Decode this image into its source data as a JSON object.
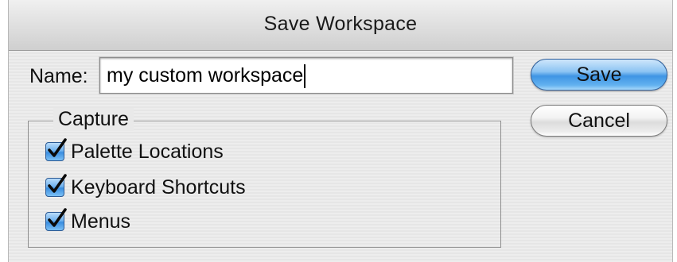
{
  "dialog": {
    "title": "Save Workspace",
    "name_label": "Name:",
    "name_value": "my custom workspace",
    "buttons": {
      "save": "Save",
      "cancel": "Cancel"
    },
    "capture": {
      "title": "Capture",
      "options": [
        {
          "label": "Palette Locations",
          "checked": true
        },
        {
          "label": "Keyboard Shortcuts",
          "checked": true
        },
        {
          "label": "Menus",
          "checked": true
        }
      ]
    }
  },
  "colors": {
    "default_button": "#4a9ce6",
    "checkbox": "#5aa7ec"
  },
  "icons": {
    "checkmark": "checkmark-icon"
  }
}
